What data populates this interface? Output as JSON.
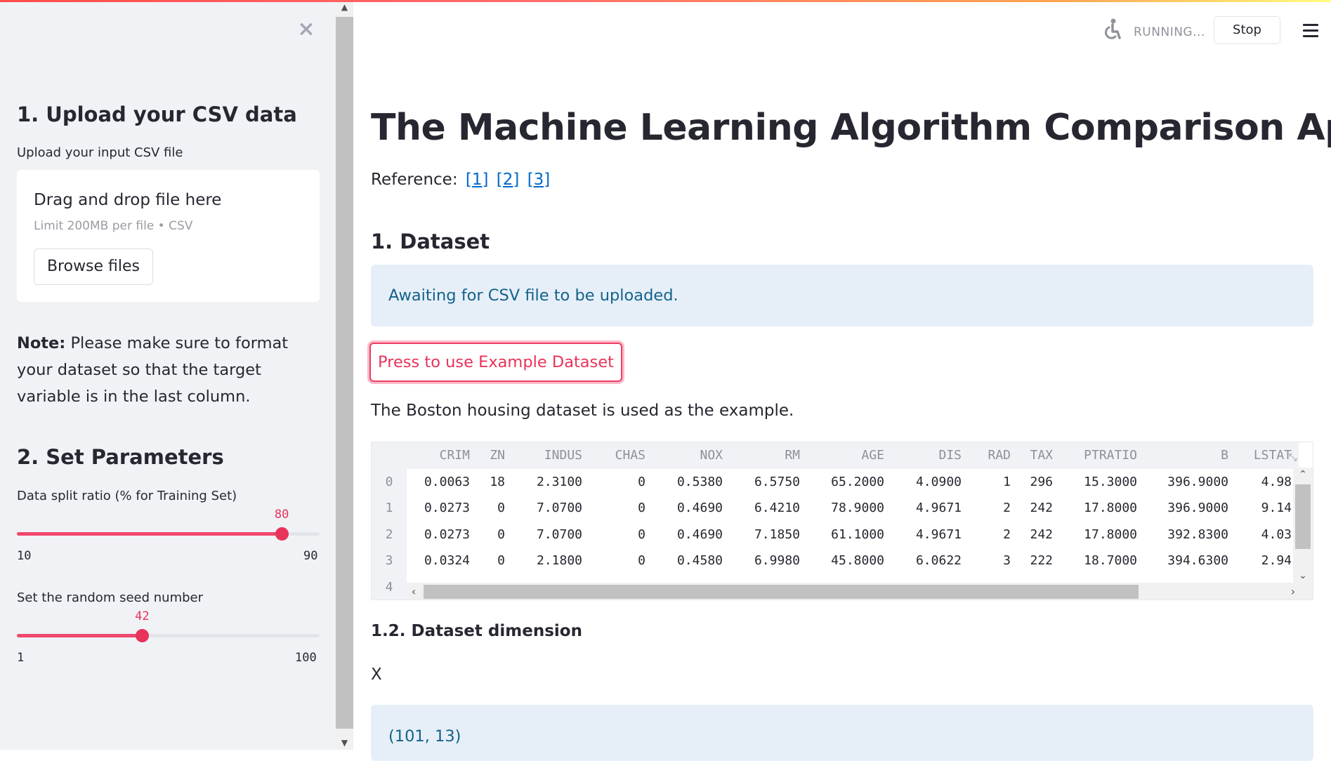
{
  "sidebar": {
    "close_icon": "close-icon",
    "upload_heading": "1. Upload your CSV data",
    "upload_label": "Upload your input CSV file",
    "dropzone_title": "Drag and drop file here",
    "dropzone_limit": "Limit 200MB per file • CSV",
    "browse_label": "Browse files",
    "note_bold": "Note:",
    "note_text": " Please make sure to format your dataset so that the target variable is in the last column.",
    "params_heading": "2. Set Parameters",
    "split_slider": {
      "label": "Data split ratio (% for Training Set)",
      "value": "80",
      "min": "10",
      "max": "90",
      "fraction": 0.875
    },
    "seed_slider": {
      "label": "Set the random seed number",
      "value": "42",
      "min": "1",
      "max": "100",
      "fraction": 0.414
    }
  },
  "header": {
    "status": "RUNNING...",
    "stop_label": "Stop",
    "menu_icon": "hamburger-menu-icon"
  },
  "main": {
    "title": "The Machine Learning Algorithm Comparison App",
    "reference_label": "Reference:",
    "references": [
      "[1]",
      "[2]",
      "[3]"
    ],
    "dataset_heading": "1. Dataset",
    "info_message": "Awaiting for CSV file to be uploaded.",
    "example_button": "Press to use Example Dataset",
    "example_note": "The Boston housing dataset is used as the example.",
    "table": {
      "columns": [
        "",
        "CRIM",
        "ZN",
        "INDUS",
        "CHAS",
        "NOX",
        "RM",
        "AGE",
        "DIS",
        "RAD",
        "TAX",
        "PTRATIO",
        "B",
        "LSTAT"
      ],
      "rows": [
        [
          "0",
          "0.0063",
          "18",
          "2.3100",
          "0",
          "0.5380",
          "6.5750",
          "65.2000",
          "4.0900",
          "1",
          "296",
          "15.3000",
          "396.9000",
          "4.98"
        ],
        [
          "1",
          "0.0273",
          "0",
          "7.0700",
          "0",
          "0.4690",
          "6.4210",
          "78.9000",
          "4.9671",
          "2",
          "242",
          "17.8000",
          "396.9000",
          "9.14"
        ],
        [
          "2",
          "0.0273",
          "0",
          "7.0700",
          "0",
          "0.4690",
          "7.1850",
          "61.1000",
          "4.9671",
          "2",
          "242",
          "17.8000",
          "392.8300",
          "4.03"
        ],
        [
          "3",
          "0.0324",
          "0",
          "2.1800",
          "0",
          "0.4580",
          "6.9980",
          "45.8000",
          "6.0622",
          "3",
          "222",
          "18.7000",
          "394.6300",
          "2.94"
        ],
        [
          "4",
          "",
          "",
          "",
          "",
          "",
          "",
          "",
          "",
          "",
          "",
          "",
          "",
          ""
        ]
      ]
    },
    "dimension_heading": "1.2. Dataset dimension",
    "x_label": "X",
    "x_shape": "(101, 13)"
  },
  "colors": {
    "accent": "#e8335a",
    "info_bg": "#e6eff8",
    "info_text": "#14628a",
    "link": "#0068c9"
  }
}
